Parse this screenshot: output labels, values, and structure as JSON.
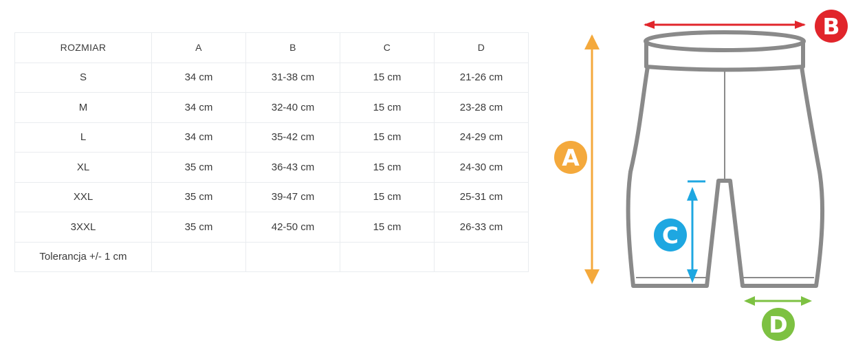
{
  "table": {
    "headers": [
      "ROZMIAR",
      "A",
      "B",
      "C",
      "D"
    ],
    "rows": [
      [
        "S",
        "34 cm",
        "31-38 cm",
        "15 cm",
        "21-26 cm"
      ],
      [
        "M",
        "34 cm",
        "32-40 cm",
        "15 cm",
        "23-28 cm"
      ],
      [
        "L",
        "34 cm",
        "35-42 cm",
        "15 cm",
        "24-29 cm"
      ],
      [
        "XL",
        "35 cm",
        "36-43 cm",
        "15 cm",
        "24-30 cm"
      ],
      [
        "XXL",
        "35 cm",
        "39-47 cm",
        "15 cm",
        "25-31 cm"
      ],
      [
        "3XXL",
        "35 cm",
        "42-50 cm",
        "15 cm",
        "26-33 cm"
      ]
    ],
    "footer": [
      "Tolerancja +/- 1 cm",
      "",
      "",
      "",
      ""
    ]
  },
  "diagram": {
    "badges": [
      {
        "key": "a",
        "letter": "A",
        "color": "#f4a93c"
      },
      {
        "key": "b",
        "letter": "B",
        "color": "#e1252b"
      },
      {
        "key": "c",
        "letter": "C",
        "color": "#1ea7e1"
      },
      {
        "key": "d",
        "letter": "D",
        "color": "#7dc142"
      }
    ],
    "garment_color": "#8a8a8a"
  }
}
